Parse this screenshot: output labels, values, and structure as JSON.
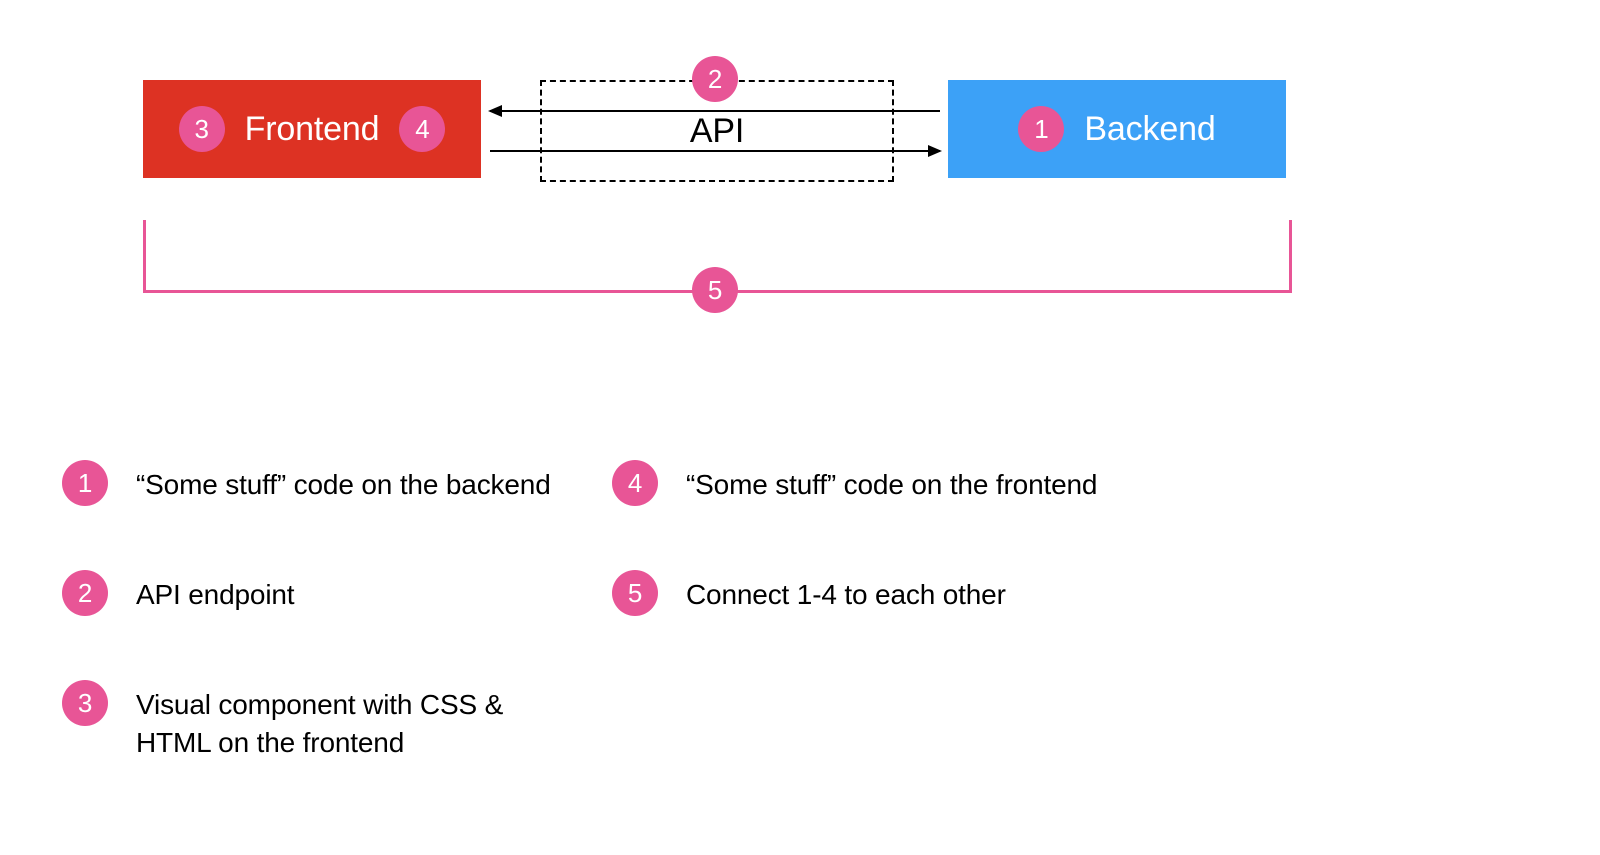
{
  "colors": {
    "frontend": "#dd3223",
    "backend": "#3ca1f7",
    "badge": "#e85596"
  },
  "boxes": {
    "frontend": "Frontend",
    "api": "API",
    "backend": "Backend"
  },
  "badges": {
    "b1": "1",
    "b2": "2",
    "b3": "3",
    "b4": "4",
    "b5": "5"
  },
  "legend": {
    "i1": "“Some stuff” code on the backend",
    "i2": "API endpoint",
    "i3": "Visual component with CSS & HTML on the frontend",
    "i4": "“Some stuff” code on the frontend",
    "i5": "Connect 1-4 to each other"
  }
}
